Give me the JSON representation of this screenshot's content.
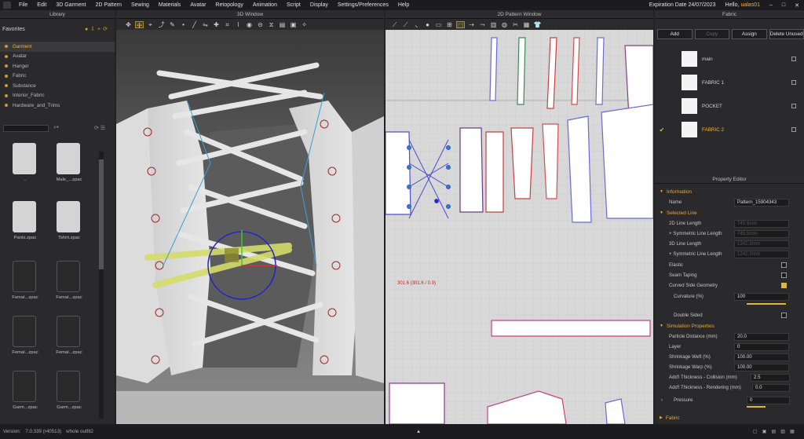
{
  "menu": {
    "items": [
      "File",
      "Edit",
      "3D Garment",
      "2D Pattern",
      "Sewing",
      "Materials",
      "Avatar",
      "Retopology",
      "Animation",
      "Script",
      "Display",
      "Settings/Preferences",
      "Help"
    ],
    "expiration": "Expiration Date 24/07/2023",
    "hello": "Hello,",
    "user": "ualas01"
  },
  "library": {
    "title": "Library",
    "favorites": "Favorites",
    "tree": [
      "Garment",
      "Avatar",
      "Hanger",
      "Fabric",
      "Substance",
      "Interior_Fabric",
      "Hardware_and_Trims"
    ],
    "assets": [
      {
        "label": "..",
        "tone": "light"
      },
      {
        "label": "Male_...zpac",
        "tone": "light"
      },
      {
        "label": "Pants.zpac",
        "tone": "light"
      },
      {
        "label": "Tshirt.zpac",
        "tone": "light"
      },
      {
        "label": "Femal...zpac",
        "tone": "dark"
      },
      {
        "label": "Femal...zpac",
        "tone": "dark"
      },
      {
        "label": "Femal...zpac",
        "tone": "dark"
      },
      {
        "label": "Femal...zpac",
        "tone": "dark"
      },
      {
        "label": "Garm...zpac",
        "tone": "dark"
      },
      {
        "label": "Garm...zpac",
        "tone": "dark"
      }
    ]
  },
  "window3d": {
    "title": "3D Window"
  },
  "window2d": {
    "title": "2D Pattern Window",
    "coord": "301.6 (301.6 / 0.0)"
  },
  "fabric": {
    "title": "Fabric",
    "buttons": [
      "Add",
      "Copy",
      "Assign",
      "Delete Unused"
    ],
    "items": [
      {
        "name": "main",
        "selected": false
      },
      {
        "name": "FABRIC 1",
        "selected": false
      },
      {
        "name": "POCKET",
        "selected": false
      },
      {
        "name": "FABRIC 2",
        "selected": true
      }
    ],
    "check": "✔"
  },
  "property": {
    "title": "Property Editor",
    "information": "Information",
    "name_label": "Name",
    "name_value": "Pattern_15904343",
    "selected_line": "Selected Line",
    "line2d_label": "2D Line Length",
    "line2d_value": "745.5mm",
    "sym2d_label": "+ Symmetric Line Length",
    "sym2d_value": "745.5mm",
    "line3d_label": "3D Line Length",
    "line3d_value": "1242.3mm",
    "sym3d_label": "+ Symmetric Line Length",
    "sym3d_value": "1242.3mm",
    "elastic": "Elastic",
    "seam_taping": "Seam Taping",
    "curved": "Curved Side Geometry",
    "curvature_label": "Curvature (%)",
    "curvature_value": "100",
    "double_sided": "Double Sided",
    "simulation": "Simulation Properties",
    "particle_label": "Particle Distance (mm)",
    "particle_value": "20.0",
    "layer_label": "Layer",
    "layer_value": "0",
    "weft_label": "Shrinkage Weft (%)",
    "weft_value": "100.00",
    "warp_label": "Shrinkage Warp (%)",
    "warp_value": "100.00",
    "coll_label": "Add'l Thickness - Collision (mm)",
    "coll_value": "2.5",
    "rend_label": "Add'l Thickness - Rendering (mm)",
    "rend_value": "0.0",
    "pressure_label": "Pressure",
    "pressure_value": "0",
    "fabric_section": "Fabric"
  },
  "status": {
    "version_label": "Version:",
    "version": "7.0.339 (r40513)",
    "file": "whole outfit2"
  }
}
